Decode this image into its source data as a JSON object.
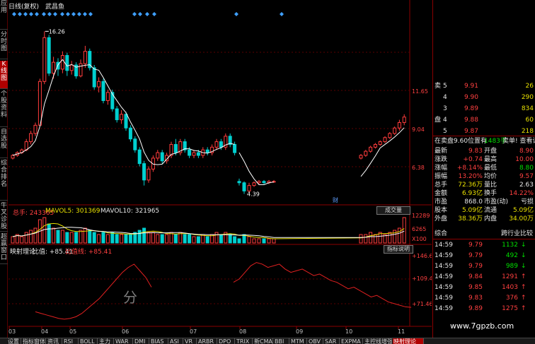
{
  "chart_header": {
    "period": "日线(复权)",
    "name": "武昌鱼",
    "high_label": "16.26",
    "low_label": "4.39",
    "cai_label": "财"
  },
  "left_tabs": [
    {
      "label": "应用"
    },
    {
      "label": "分时图"
    },
    {
      "label": "K线图",
      "active": true
    },
    {
      "label": "个股资料"
    },
    {
      "label": "自选股"
    },
    {
      "label": "综合排名"
    },
    {
      "label": "牛叉诊股"
    },
    {
      "label": "超赢窗口"
    }
  ],
  "price_axis": [
    "11.65",
    "9.04",
    "6.38"
  ],
  "volume_axis": [
    "12289",
    "6265",
    "X100"
  ],
  "indicator_axis": [
    "+146.6",
    "+109.4",
    "+71.46"
  ],
  "date_axis": [
    "03",
    "04",
    "05",
    "06",
    "07",
    "08",
    "09",
    "10",
    "11"
  ],
  "volume_header": {
    "total": "总手: 243365",
    "ma5": "MAVOL5: 301369",
    "ma10": "MAVOL10: 321965",
    "button": "成交量"
  },
  "indicator_header": {
    "name": "映射理论",
    "ratio": "比值: +85.41",
    "ratio_line": "比值线: +85.41",
    "button": "指标说明"
  },
  "watermark_center": "分",
  "watermark_site": "www.7gpzb.com",
  "order_book": [
    {
      "side": "卖",
      "level": "5",
      "price": "9.91",
      "vol": "26"
    },
    {
      "side": "",
      "level": "4",
      "price": "9.90",
      "vol": "290"
    },
    {
      "side": "",
      "level": "3",
      "price": "9.89",
      "vol": "834"
    },
    {
      "side": "盘",
      "level": "4",
      "price": "9.88",
      "vol": "60"
    },
    {
      "side": "",
      "level": "5",
      "price": "9.87",
      "vol": "218"
    }
  ],
  "order_note": {
    "a": "在卖盘9.60位置有",
    "b": "1483手",
    "c": "卖单! 查看详细"
  },
  "stats": [
    {
      "l1": "最新",
      "v1": "9.83",
      "l2": "开盘",
      "v2": "8.90"
    },
    {
      "l1": "涨跌",
      "v1": "+0.74",
      "l2": "最高",
      "v2": "10.00"
    },
    {
      "l1": "涨幅",
      "v1": "+8.14%",
      "l2": "最低",
      "v2": "8.80"
    },
    {
      "l1": "振幅",
      "v1": "13.20%",
      "l2": "均价",
      "v2": "9.57"
    },
    {
      "l1": "总手",
      "v1": "72.36万",
      "l2": "量比",
      "v2": "2.63"
    },
    {
      "l1": "金额",
      "v1": "6.93亿",
      "l2": "换手",
      "v2": "14.22%"
    },
    {
      "l1": "市盈",
      "v1": "868.0",
      "l2": "市盈(动)",
      "v2": "亏损"
    },
    {
      "l1": "股本",
      "v1": "5.09亿",
      "l2": "流通",
      "v2": "5.09亿"
    },
    {
      "l1": "外盘",
      "v1": "38.36万",
      "l2": "内盘",
      "v2": "34.00万"
    }
  ],
  "trades_header": {
    "left": "综合",
    "right": "跨行业比较"
  },
  "trades": [
    {
      "time": "14:59",
      "price": "9.79",
      "vol": "1132",
      "dir": "down"
    },
    {
      "time": "14:59",
      "price": "9.79",
      "vol": "492",
      "dir": "down"
    },
    {
      "time": "14:59",
      "price": "9.79",
      "vol": "989",
      "dir": "down"
    },
    {
      "time": "14:59",
      "price": "9.84",
      "vol": "1291",
      "dir": "up"
    },
    {
      "time": "14:59",
      "price": "9.85",
      "vol": "1403",
      "dir": "up"
    },
    {
      "time": "14:59",
      "price": "9.83",
      "vol": "376",
      "dir": "up"
    },
    {
      "time": "14:59",
      "price": "9.89",
      "vol": "1275",
      "dir": "up"
    }
  ],
  "bottom_tabs": [
    {
      "label": "设置"
    },
    {
      "label": "指标窗体"
    },
    {
      "label": "资讯"
    },
    {
      "label": "RSI"
    },
    {
      "label": "BOLL"
    },
    {
      "label": "主力"
    },
    {
      "label": "WAR"
    },
    {
      "label": "DMI"
    },
    {
      "label": "BIAS"
    },
    {
      "label": "ASI"
    },
    {
      "label": "VR"
    },
    {
      "label": "ARBR"
    },
    {
      "label": "DPO"
    },
    {
      "label": "TRIX"
    },
    {
      "label": "新CMA"
    },
    {
      "label": "BBI"
    },
    {
      "label": "MTM"
    },
    {
      "label": "OBV"
    },
    {
      "label": "SAR"
    },
    {
      "label": "EXPMA"
    },
    {
      "label": "主控线增强"
    },
    {
      "label": "映射理论",
      "active": true
    }
  ],
  "colors": {
    "up": "#ff3c3c",
    "down": "#00d0d0",
    "ma": "#ffffff",
    "diamond": "#3fa0ff"
  },
  "chart_data": {
    "type": "candlestick",
    "title": "武昌鱼",
    "ylim": [
      4.0,
      17.0
    ],
    "x": [
      "03",
      "04",
      "05",
      "06",
      "07",
      "08",
      "09",
      "10",
      "11"
    ],
    "candles": [
      [
        7.0,
        7.2,
        6.9,
        7.3
      ],
      [
        7.2,
        7.4,
        7.1,
        7.5
      ],
      [
        7.4,
        7.6,
        7.3,
        7.7
      ],
      [
        7.6,
        8.2,
        7.5,
        8.4
      ],
      [
        8.2,
        8.8,
        8.0,
        9.0
      ],
      [
        8.8,
        9.4,
        8.6,
        9.6
      ],
      [
        9.4,
        12.6,
        9.3,
        12.8
      ],
      [
        12.6,
        15.8,
        12.4,
        16.26
      ],
      [
        15.8,
        13.2,
        13.0,
        16.0
      ],
      [
        13.2,
        14.0,
        12.8,
        14.4
      ],
      [
        14.0,
        13.5,
        13.0,
        14.3
      ],
      [
        13.5,
        14.5,
        13.2,
        14.8
      ],
      [
        14.5,
        13.4,
        13.0,
        14.7
      ],
      [
        13.4,
        13.8,
        13.1,
        14.1
      ],
      [
        13.8,
        13.0,
        12.8,
        14.0
      ],
      [
        13.0,
        13.9,
        12.9,
        14.2
      ],
      [
        13.9,
        14.8,
        13.6,
        15.2
      ],
      [
        14.8,
        13.6,
        13.4,
        15.0
      ],
      [
        13.6,
        12.2,
        12.0,
        13.8
      ],
      [
        12.2,
        12.6,
        11.8,
        12.9
      ],
      [
        12.6,
        11.2,
        11.0,
        12.8
      ],
      [
        11.2,
        11.8,
        10.9,
        12.0
      ],
      [
        11.8,
        10.6,
        10.4,
        12.0
      ],
      [
        10.6,
        9.8,
        9.6,
        10.8
      ],
      [
        9.8,
        10.2,
        9.5,
        10.5
      ],
      [
        10.2,
        9.2,
        9.0,
        10.4
      ],
      [
        9.2,
        8.4,
        8.2,
        9.4
      ],
      [
        8.4,
        7.6,
        7.4,
        8.6
      ],
      [
        7.6,
        6.6,
        6.4,
        7.8
      ],
      [
        6.6,
        5.4,
        5.0,
        6.8
      ],
      [
        5.4,
        6.2,
        5.2,
        6.4
      ],
      [
        6.2,
        7.0,
        6.0,
        7.2
      ],
      [
        7.0,
        7.4,
        6.8,
        7.6
      ],
      [
        7.4,
        6.8,
        6.6,
        7.6
      ],
      [
        6.8,
        7.2,
        6.6,
        7.4
      ],
      [
        7.2,
        8.0,
        7.0,
        8.2
      ],
      [
        8.0,
        7.4,
        7.2,
        8.4
      ],
      [
        7.4,
        8.2,
        7.2,
        8.4
      ],
      [
        8.2,
        7.6,
        7.4,
        8.4
      ],
      [
        7.6,
        7.2,
        7.0,
        7.8
      ],
      [
        7.2,
        7.4,
        7.0,
        7.6
      ],
      [
        7.4,
        7.2,
        7.0,
        7.6
      ],
      [
        7.2,
        7.6,
        7.0,
        7.8
      ],
      [
        7.6,
        7.4,
        7.2,
        7.8
      ],
      [
        7.4,
        7.8,
        7.2,
        8.0
      ],
      [
        7.8,
        8.2,
        7.6,
        8.4
      ],
      [
        8.2,
        7.8,
        7.6,
        8.4
      ],
      [
        7.8,
        8.6,
        7.6,
        8.8
      ],
      [
        8.6,
        8.0,
        7.8,
        8.8
      ],
      [
        8.0,
        7.4,
        7.2,
        8.2
      ],
      [
        5.3,
        5.2,
        5.0,
        5.5
      ],
      [
        5.2,
        4.6,
        4.39,
        5.3
      ],
      [
        4.6,
        5.0,
        4.5,
        5.2
      ],
      [
        5.0,
        5.2,
        4.9,
        5.3
      ],
      [
        5.2,
        5.3,
        5.1,
        5.4
      ],
      [
        5.3,
        5.2,
        5.1,
        5.4
      ],
      [
        5.2,
        5.3,
        5.1,
        5.4
      ],
      [
        5.3,
        5.3,
        5.2,
        5.4
      ],
      [
        7.0,
        7.2,
        6.9,
        7.3
      ],
      [
        7.2,
        7.5,
        7.1,
        7.6
      ],
      [
        7.5,
        7.8,
        7.4,
        7.9
      ],
      [
        7.8,
        8.0,
        7.7,
        8.1
      ],
      [
        8.0,
        8.2,
        7.9,
        8.3
      ],
      [
        8.2,
        8.5,
        8.1,
        8.6
      ],
      [
        8.5,
        8.8,
        8.4,
        8.9
      ],
      [
        8.8,
        9.2,
        8.7,
        9.3
      ],
      [
        9.2,
        9.6,
        9.0,
        9.8
      ],
      [
        9.6,
        10.0,
        9.4,
        10.2
      ]
    ],
    "volume": [
      3,
      4,
      3,
      5,
      6,
      7,
      11,
      12,
      9,
      7,
      6,
      6,
      5,
      5,
      5,
      6,
      7,
      6,
      5,
      4,
      5,
      4,
      5,
      4,
      4,
      4,
      4,
      5,
      6,
      7,
      5,
      5,
      4,
      4,
      4,
      5,
      4,
      5,
      4,
      4,
      3,
      3,
      4,
      3,
      4,
      5,
      4,
      5,
      4,
      3,
      2,
      4,
      3,
      2,
      2,
      2,
      2,
      2,
      4,
      4,
      5,
      4,
      5,
      4,
      5,
      6,
      7,
      12
    ],
    "indicator": [
      80,
      78,
      76,
      74,
      72,
      71,
      72,
      74,
      78,
      84,
      90,
      96,
      104,
      112,
      120,
      128,
      134,
      138,
      130,
      122,
      110,
      null,
      null,
      null,
      null,
      null,
      null,
      null,
      null,
      null,
      null,
      null,
      null,
      116,
      120,
      128,
      136,
      140,
      138,
      134,
      136,
      138,
      132,
      128,
      130,
      132,
      128,
      124,
      126,
      122,
      118,
      116,
      112,
      108,
      110,
      106,
      102,
      98,
      100,
      96,
      92,
      90,
      88,
      86,
      85.41
    ],
    "indicator_ylim": [
      64,
      150
    ]
  }
}
